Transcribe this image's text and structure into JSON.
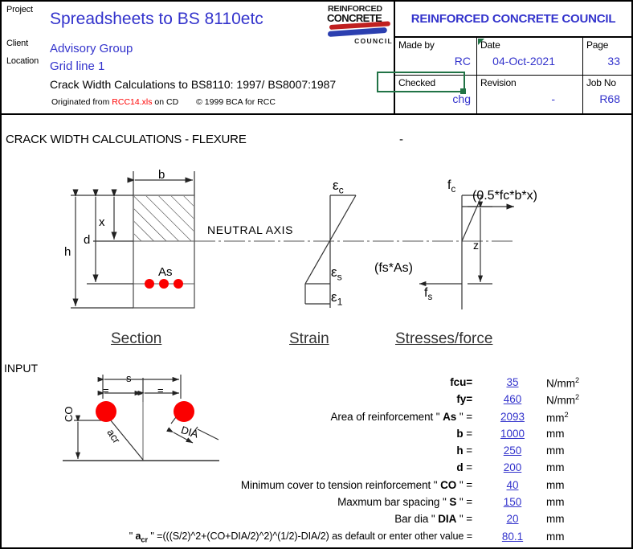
{
  "header": {
    "labels": {
      "project": "Project",
      "client": "Client",
      "location": "Location"
    },
    "project_title": "Spreadsheets to BS 8110etc",
    "client": "Advisory Group",
    "location": "Grid line 1",
    "subtitle": "Crack Width Calculations to BS8110: 1997/ BS8007:1987",
    "origin_prefix": "Originated from ",
    "origin_file": "RCC14.xls",
    "origin_suffix": " on CD",
    "copyright": "© 1999 BCA for RCC",
    "logo": {
      "line1": "REINFORCED",
      "line2": "CONCRETE",
      "line3": "COUNCIL"
    },
    "org_title": "REINFORCED CONCRETE COUNCIL",
    "made_by_label": "Made by",
    "made_by_value": "RC",
    "date_label": "Date",
    "date_value": "04-Oct-2021",
    "page_label": "Page",
    "page_value": "33",
    "checked_label": "Checked",
    "checked_value": "chg",
    "revision_label": "Revision",
    "revision_value": "-",
    "job_no_label": "Job No",
    "job_no_value": "R68"
  },
  "main": {
    "title": "CRACK WIDTH CALCULATIONS - FLEXURE",
    "title_suffix": "-",
    "input_label": "INPUT"
  },
  "diagram": {
    "captions": {
      "section": "Section",
      "strain": "Strain",
      "stress": "Stresses/force"
    },
    "section_labels": {
      "b": "b",
      "x": "x",
      "d": "d",
      "h": "h",
      "as": "As",
      "neutral_axis": "NEUTRAL  AXIS"
    },
    "strain_labels": {
      "ec": "ε",
      "ec_sub": "c",
      "es": "ε",
      "es_sub": "s",
      "e1": "ε",
      "e1_sub": "1"
    },
    "stress_labels": {
      "fc": "f",
      "fc_sub": "c",
      "fs": "f",
      "fs_sub": "s",
      "compression_force": "(0.5*fc*b*x)",
      "tension_force": "(fs*As)",
      "lever_arm": "z"
    },
    "crack_labels": {
      "s": "s",
      "eq_left": "=",
      "eq_right": "=",
      "co": "CO",
      "acr": "acr",
      "dia": "DIA"
    }
  },
  "inputs": {
    "rows": [
      {
        "label_html": "<b>fcu=</b>",
        "value": "35",
        "unit_html": "N/mm<sup>2</sup>"
      },
      {
        "label_html": "<b>fy=</b>",
        "value": "460",
        "unit_html": "N/mm<sup>2</sup>"
      },
      {
        "label_html": "Area of reinforcement \" <b>As</b> \" =",
        "value": "2093",
        "unit_html": "mm<sup>2</sup>"
      },
      {
        "label_html": "<b>b</b> =",
        "value": "1000",
        "unit_html": "mm"
      },
      {
        "label_html": "<b>h</b> =",
        "value": "250",
        "unit_html": "mm"
      },
      {
        "label_html": "<b>d</b> =",
        "value": "200",
        "unit_html": "mm"
      },
      {
        "label_html": "Minimum cover to tension reinforcement \" <b>CO</b> \" =",
        "value": "40",
        "unit_html": "mm"
      },
      {
        "label_html": "Maxmum bar spacing \" <b>S</b> \" =",
        "value": "150",
        "unit_html": "mm"
      },
      {
        "label_html": "Bar dia \" <b>DIA</b> \" =",
        "value": "20",
        "unit_html": "mm"
      },
      {
        "label_html": "\" <b>a<span class='tiny'>cr</span></b> \" =(((S/2)^2+(CO+DIA/2)^2)^(1/2)-DIA/2) as default or enter other value =",
        "value": "80.1",
        "unit_html": "mm",
        "formula": true
      }
    ]
  },
  "colors": {
    "link_blue": "#3333cc",
    "rebar_red": "#ff0000",
    "selection_green": "#217346",
    "text_black": "#000000"
  }
}
